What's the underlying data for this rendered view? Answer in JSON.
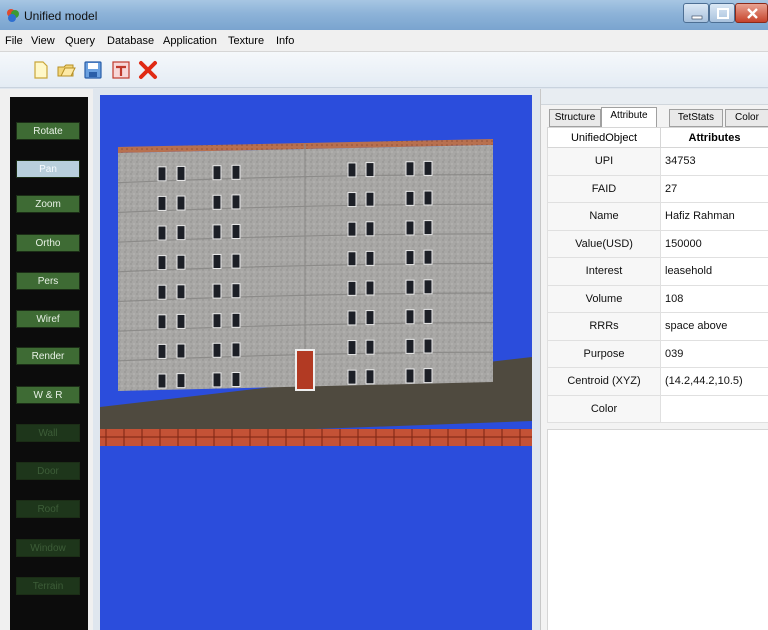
{
  "window": {
    "title": "Unified model"
  },
  "menu": [
    "File",
    "View",
    "Query",
    "Database",
    "Application",
    "Texture",
    "Info"
  ],
  "toolbar": {
    "icons": [
      "new-file-icon",
      "open-icon",
      "save-icon",
      "export-icon",
      "delete-icon"
    ]
  },
  "sidebar": {
    "buttons": [
      {
        "label": "Rotate",
        "state": "on"
      },
      {
        "label": "Pan",
        "state": "selected"
      },
      {
        "label": "Zoom",
        "state": "on"
      },
      {
        "label": "Ortho",
        "state": "on"
      },
      {
        "label": "Pers",
        "state": "on"
      },
      {
        "label": "Wiref",
        "state": "on"
      },
      {
        "label": "Render",
        "state": "on"
      },
      {
        "label": "W & R",
        "state": "on"
      },
      {
        "label": "Wall",
        "state": "disabled"
      },
      {
        "label": "Door",
        "state": "disabled"
      },
      {
        "label": "Roof",
        "state": "disabled"
      },
      {
        "label": "Window",
        "state": "disabled"
      },
      {
        "label": "Terrain",
        "state": "disabled"
      }
    ]
  },
  "tabs": [
    "Structure",
    "Attribute",
    "TetStats",
    "Color"
  ],
  "active_tab": "Attribute",
  "table": {
    "headers": [
      "UnifiedObject",
      "Attributes"
    ],
    "rows": [
      {
        "key": "UPI",
        "value": "34753"
      },
      {
        "key": "FAID",
        "value": "27"
      },
      {
        "key": "Name",
        "value": "Hafiz Rahman"
      },
      {
        "key": "Value(USD)",
        "value": "150000"
      },
      {
        "key": "Interest",
        "value": "leasehold"
      },
      {
        "key": "Volume",
        "value": "108"
      },
      {
        "key": "RRRs",
        "value": "space above"
      },
      {
        "key": "Purpose",
        "value": "039"
      },
      {
        "key": "Centroid (XYZ)",
        "value": "(14.2,44.2,10.5)"
      },
      {
        "key": "Color",
        "value": ""
      }
    ]
  },
  "colors": {
    "viewport_bg": "#2b4ddc",
    "building_wall": "#a9a9a9",
    "roof": "#b4654a",
    "window": "#1c1f26",
    "door": "#b23a23",
    "ground": "#4f4a3f",
    "fence": "#b5452e",
    "sidebar_on": "#3e6b34",
    "sidebar_off": "#1e361b"
  }
}
